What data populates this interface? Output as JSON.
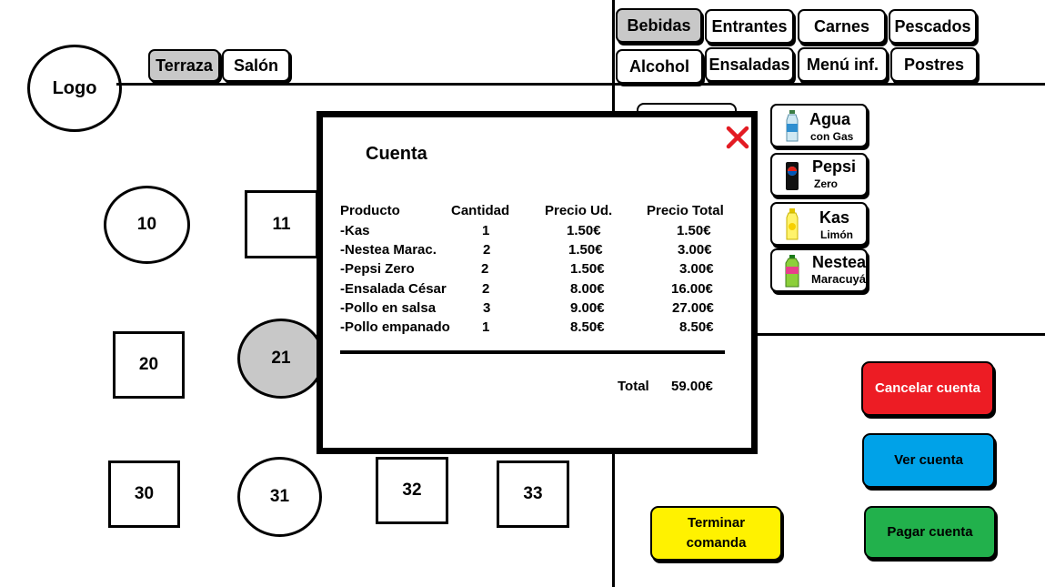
{
  "logo": {
    "label": "Logo"
  },
  "rooms": [
    {
      "label": "Terraza",
      "selected": true
    },
    {
      "label": "Salón",
      "selected": false
    }
  ],
  "categories": [
    {
      "label": "Bebidas",
      "selected": true
    },
    {
      "label": "Entrantes",
      "selected": false
    },
    {
      "label": "Carnes",
      "selected": false
    },
    {
      "label": "Pescados",
      "selected": false
    },
    {
      "label": "Alcohol",
      "selected": false
    },
    {
      "label": "Ensaladas",
      "selected": false
    },
    {
      "label": "Menú inf.",
      "selected": false
    },
    {
      "label": "Postres",
      "selected": false
    }
  ],
  "tables": [
    {
      "number": "10",
      "shape": "round"
    },
    {
      "number": "11",
      "shape": "square"
    },
    {
      "number": "20",
      "shape": "square"
    },
    {
      "number": "21",
      "shape": "round",
      "selected": true
    },
    {
      "number": "30",
      "shape": "square"
    },
    {
      "number": "31",
      "shape": "round"
    },
    {
      "number": "32",
      "shape": "square"
    },
    {
      "number": "33",
      "shape": "square"
    }
  ],
  "drinks": [
    {
      "name": "Agua",
      "sub": "con Gas",
      "icon": "water-bottle-icon"
    },
    {
      "name": "Pepsi",
      "sub": "Zero",
      "icon": "soda-can-icon"
    },
    {
      "name": "Kas",
      "sub": "Limón",
      "icon": "lemon-drink-icon"
    },
    {
      "name": "Nestea",
      "sub": "Maracuyá",
      "icon": "tea-bottle-icon"
    }
  ],
  "actions": {
    "cancel": {
      "label": "Cancelar cuenta",
      "color": "#ed1c24"
    },
    "view": {
      "label": "Ver cuenta",
      "color": "#00a2e8"
    },
    "finish": {
      "label_line1": "Terminar",
      "label_line2": "comanda",
      "color": "#fff200"
    },
    "pay": {
      "label": "Pagar cuenta",
      "color": "#22b14c"
    }
  },
  "bill": {
    "title": "Cuenta",
    "headers": {
      "product": "Producto",
      "qty": "Cantidad",
      "unit": "Precio Ud.",
      "total": "Precio Total"
    },
    "rows": [
      {
        "product": "-Kas",
        "qty": "1",
        "unit": "1.50€",
        "total": "1.50€"
      },
      {
        "product": "-Nestea Marac.",
        "qty": "2",
        "unit": "1.50€",
        "total": "3.00€"
      },
      {
        "product": "-Pepsi Zero",
        "qty": "2",
        "unit": "1.50€",
        "total": "3.00€"
      },
      {
        "product": "-Ensalada César",
        "qty": "2",
        "unit": "8.00€",
        "total": "16.00€"
      },
      {
        "product": "-Pollo en salsa",
        "qty": "3",
        "unit": "9.00€",
        "total": "27.00€"
      },
      {
        "product": "-Pollo empanado",
        "qty": "1",
        "unit": "8.50€",
        "total": "8.50€"
      }
    ],
    "total_label": "Total",
    "total_value": "59.00€",
    "close_icon": "close-icon",
    "close_color": "#e31b23"
  }
}
